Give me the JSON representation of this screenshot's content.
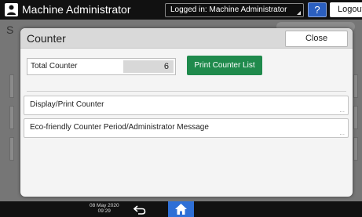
{
  "topbar": {
    "app_title": "Machine Administrator",
    "login_status": "Logged in: Machine Administrator",
    "help_label": "?",
    "logout_label": "Logout",
    "extra_glyph": "("
  },
  "background": {
    "partial_letter": "S"
  },
  "dialog": {
    "title": "Counter",
    "close_label": "Close",
    "total_counter_label": "Total Counter",
    "total_counter_value": "6",
    "print_counter_list_label": "Print Counter List",
    "menu_items": [
      {
        "label": "Display/Print Counter",
        "more": "..."
      },
      {
        "label": "Eco-friendly Counter Period/Administrator Message",
        "more": "..."
      }
    ]
  },
  "bottombar": {
    "date": "08 May 2020",
    "time": "09:29"
  },
  "colors": {
    "accent_green": "#1f8a4c",
    "home_blue": "#2e6fd6",
    "help_blue": "#2b5fbf"
  },
  "icons": [
    "user-icon",
    "help-icon",
    "back-arrow-icon",
    "home-icon"
  ]
}
